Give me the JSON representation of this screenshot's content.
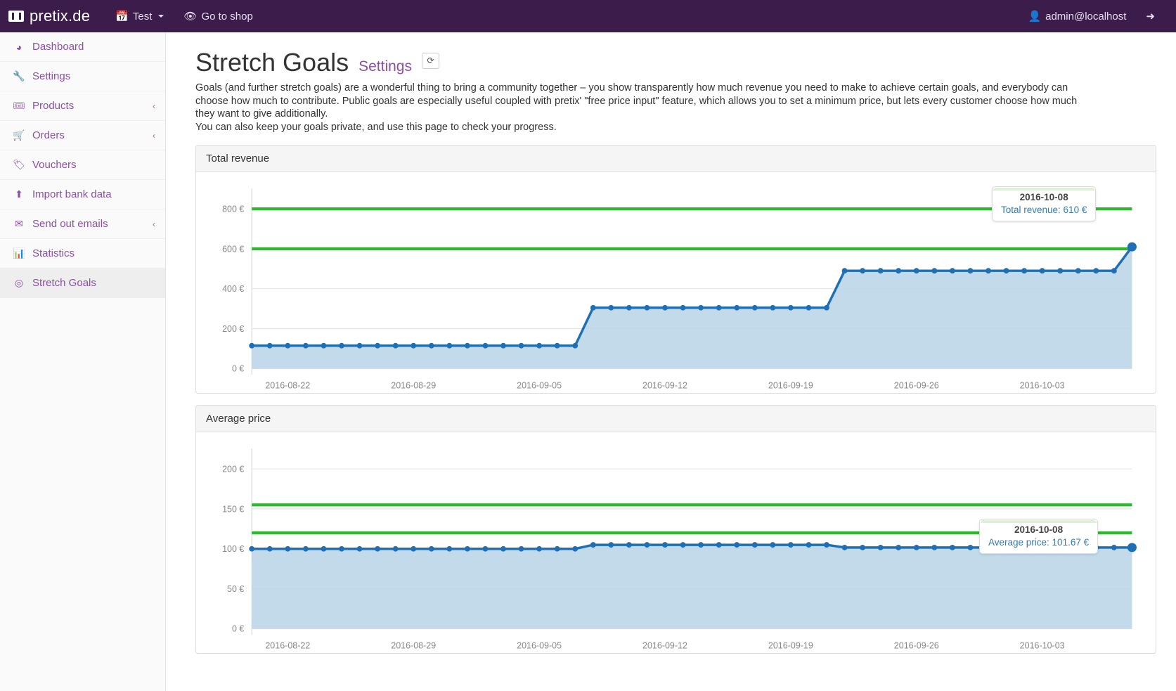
{
  "navbar": {
    "brand": "pretix.de",
    "logo_letter": "p",
    "event_selector": "Test",
    "event_icon": "calendar-icon",
    "go_to_shop": "Go to shop",
    "shop_icon": "eye-icon",
    "user": "admin@localhost",
    "user_icon": "user-icon",
    "logout_icon": "logout-icon",
    "bg_color": "#3b1c4a"
  },
  "sidebar": {
    "items": [
      {
        "label": "Dashboard",
        "icon": "dashboard-icon",
        "glyph": "◕",
        "chevron": "",
        "active": false
      },
      {
        "label": "Settings",
        "icon": "wrench-icon",
        "glyph": "🔧",
        "chevron": "",
        "active": false
      },
      {
        "label": "Products",
        "icon": "tags-icon",
        "glyph": "🎟",
        "chevron": "‹",
        "active": false
      },
      {
        "label": "Orders",
        "icon": "cart-icon",
        "glyph": "🛒",
        "chevron": "‹",
        "active": false
      },
      {
        "label": "Vouchers",
        "icon": "tag-icon",
        "glyph": "🏷",
        "chevron": "",
        "active": false
      },
      {
        "label": "Import bank data",
        "icon": "upload-icon",
        "glyph": "⬆",
        "chevron": "",
        "active": false
      },
      {
        "label": "Send out emails",
        "icon": "envelope-icon",
        "glyph": "✉",
        "chevron": "‹",
        "active": false
      },
      {
        "label": "Statistics",
        "icon": "bar-chart-icon",
        "glyph": "📊",
        "chevron": "",
        "active": false
      },
      {
        "label": "Stretch Goals",
        "icon": "target-icon",
        "glyph": "◎",
        "chevron": "",
        "active": true
      }
    ],
    "accent_color": "#8c4fa8"
  },
  "page": {
    "title": "Stretch Goals",
    "settings_link": "Settings",
    "refresh_icon": "refresh-icon",
    "refresh_glyph": "⟳",
    "description_1": "Goals (and further stretch goals) are a wonderful thing to bring a community together – you show transparently how much revenue you need to make to achieve certain goals, and everybody can choose how much to contribute. Public goals are especially useful coupled with pretix' \"free price input\" feature, which allows you to set a minimum price, but lets every customer choose how much they want to give additionally.",
    "description_2": "You can also keep your goals private, and use this page to check your progress."
  },
  "panels": [
    {
      "title": "Total revenue"
    },
    {
      "title": "Average price"
    }
  ],
  "chart_data": [
    {
      "type": "area",
      "title": "Total revenue",
      "xlabel": "",
      "ylabel": "",
      "ylim": [
        0,
        880
      ],
      "yticks": [
        0,
        200,
        400,
        600,
        800
      ],
      "ytick_labels": [
        "0 €",
        "200 €",
        "400 €",
        "600 €",
        "800 €"
      ],
      "xticks": [
        "2016-08-22",
        "2016-08-29",
        "2016-09-05",
        "2016-09-12",
        "2016-09-19",
        "2016-09-26",
        "2016-10-03"
      ],
      "grid": true,
      "legend": "none",
      "line_color": "#1f6fb5",
      "fill_color": "#b9d4e8",
      "goal_color": "#2eb82e",
      "goal_lines": [
        {
          "value": 600,
          "label": "600 €"
        },
        {
          "value": 800,
          "label": "800 €"
        }
      ],
      "x": [
        "2016-08-20",
        "2016-08-21",
        "2016-08-22",
        "2016-08-23",
        "2016-08-24",
        "2016-08-25",
        "2016-08-26",
        "2016-08-27",
        "2016-08-28",
        "2016-08-29",
        "2016-08-30",
        "2016-08-31",
        "2016-09-01",
        "2016-09-02",
        "2016-09-03",
        "2016-09-04",
        "2016-09-05",
        "2016-09-06",
        "2016-09-07",
        "2016-09-08",
        "2016-09-09",
        "2016-09-10",
        "2016-09-11",
        "2016-09-12",
        "2016-09-13",
        "2016-09-14",
        "2016-09-15",
        "2016-09-16",
        "2016-09-17",
        "2016-09-18",
        "2016-09-19",
        "2016-09-20",
        "2016-09-21",
        "2016-09-22",
        "2016-09-23",
        "2016-09-24",
        "2016-09-25",
        "2016-09-26",
        "2016-09-27",
        "2016-09-28",
        "2016-09-29",
        "2016-09-30",
        "2016-10-01",
        "2016-10-02",
        "2016-10-03",
        "2016-10-04",
        "2016-10-05",
        "2016-10-06",
        "2016-10-07",
        "2016-10-08"
      ],
      "values": [
        115,
        115,
        115,
        115,
        115,
        115,
        115,
        115,
        115,
        115,
        115,
        115,
        115,
        115,
        115,
        115,
        115,
        115,
        115,
        305,
        305,
        305,
        305,
        305,
        305,
        305,
        305,
        305,
        305,
        305,
        305,
        305,
        305,
        490,
        490,
        490,
        490,
        490,
        490,
        490,
        490,
        490,
        490,
        490,
        490,
        490,
        490,
        490,
        490,
        610
      ],
      "series_name": "Total revenue",
      "tooltip": {
        "date": "2016-10-08",
        "text": "Total revenue: 610 €",
        "value": 610
      }
    },
    {
      "type": "area",
      "title": "Average price",
      "xlabel": "",
      "ylabel": "",
      "ylim": [
        0,
        220
      ],
      "yticks": [
        0,
        50,
        100,
        150,
        200
      ],
      "ytick_labels": [
        "0 €",
        "50 €",
        "100 €",
        "150 €",
        "200 €"
      ],
      "xticks": [
        "2016-08-22",
        "2016-08-29",
        "2016-09-05",
        "2016-09-12",
        "2016-09-19",
        "2016-09-26",
        "2016-10-03"
      ],
      "grid": true,
      "legend": "none",
      "line_color": "#1f6fb5",
      "fill_color": "#b9d4e8",
      "goal_color": "#2eb82e",
      "goal_lines": [
        {
          "value": 120,
          "label": "120 €"
        },
        {
          "value": 155,
          "label": "155 €"
        }
      ],
      "x": [
        "2016-08-20",
        "2016-08-21",
        "2016-08-22",
        "2016-08-23",
        "2016-08-24",
        "2016-08-25",
        "2016-08-26",
        "2016-08-27",
        "2016-08-28",
        "2016-08-29",
        "2016-08-30",
        "2016-08-31",
        "2016-09-01",
        "2016-09-02",
        "2016-09-03",
        "2016-09-04",
        "2016-09-05",
        "2016-09-06",
        "2016-09-07",
        "2016-09-08",
        "2016-09-09",
        "2016-09-10",
        "2016-09-11",
        "2016-09-12",
        "2016-09-13",
        "2016-09-14",
        "2016-09-15",
        "2016-09-16",
        "2016-09-17",
        "2016-09-18",
        "2016-09-19",
        "2016-09-20",
        "2016-09-21",
        "2016-09-22",
        "2016-09-23",
        "2016-09-24",
        "2016-09-25",
        "2016-09-26",
        "2016-09-27",
        "2016-09-28",
        "2016-09-29",
        "2016-09-30",
        "2016-10-01",
        "2016-10-02",
        "2016-10-03",
        "2016-10-04",
        "2016-10-05",
        "2016-10-06",
        "2016-10-07",
        "2016-10-08"
      ],
      "values": [
        100,
        100,
        100,
        100,
        100,
        100,
        100,
        100,
        100,
        100,
        100,
        100,
        100,
        100,
        100,
        100,
        100,
        100,
        100,
        105,
        105,
        105,
        105,
        105,
        105,
        105,
        105,
        105,
        105,
        105,
        105,
        105,
        105,
        101.67,
        101.67,
        101.67,
        101.67,
        101.67,
        101.67,
        101.67,
        101.67,
        101.67,
        101.67,
        101.67,
        101.67,
        101.67,
        101.67,
        101.67,
        101.67,
        101.67
      ],
      "series_name": "Average price",
      "tooltip": {
        "date": "2016-10-08",
        "text": "Average price: 101.67 €",
        "value": 101.67
      }
    }
  ]
}
